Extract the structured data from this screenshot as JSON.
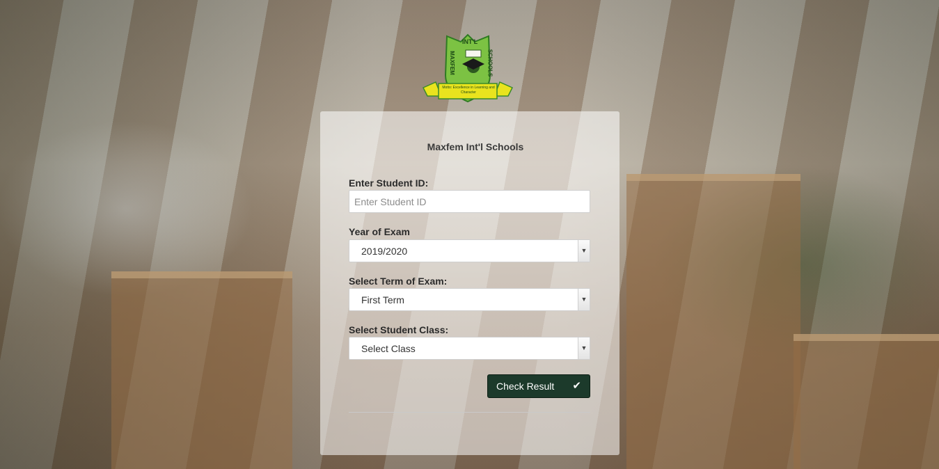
{
  "logo": {
    "top_text": "INT'L",
    "left_text": "MAXFEM",
    "right_text": "SCHOOLS",
    "banner_text": "Motto: Excellence in Learning and Character"
  },
  "school_name": "Maxfem Int'l Schools",
  "form": {
    "student_id_label": "Enter Student ID:",
    "student_id_placeholder": "Enter Student ID",
    "year_label": "Year of Exam",
    "year_value": "2019/2020",
    "term_label": "Select Term of Exam:",
    "term_value": "First Term",
    "class_label": "Select Student Class:",
    "class_value": "Select Class",
    "submit_label": "Check Result"
  }
}
